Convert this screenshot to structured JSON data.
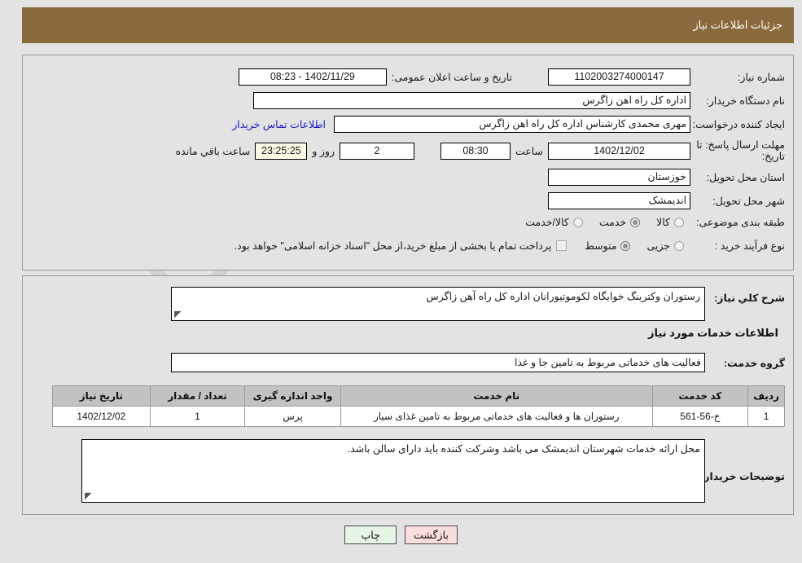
{
  "header": {
    "title": "جزئیات اطلاعات نیاز",
    "bar_color": "#8a6a3c"
  },
  "info": {
    "need_number_label": "شماره نیاز:",
    "need_number_value": "1102003274000147",
    "announce_label": "تاریخ و ساعت اعلان عمومی:",
    "announce_value": "1402/11/29 - 08:23",
    "buyer_org_label": "نام دستگاه خریدار:",
    "buyer_org_value": "اداره کل راه اهن زاگرس",
    "creator_label": "ایجاد کننده درخواست:",
    "creator_value": "مهری محمدی کارشناس اداره کل راه اهن زاگرس",
    "contact_link": "اطلاعات تماس خریدار",
    "deadline_label": "مهلت ارسال پاسخ: تا تاریخ:",
    "deadline_date": "1402/12/02",
    "hour_label": "ساعت",
    "deadline_time": "08:30",
    "days_remaining": "2",
    "days_suffix": "روز و",
    "countdown": "23:25:25",
    "countdown_suffix": "ساعت باقي مانده",
    "province_label": "استان محل تحویل:",
    "province_value": "خوزستان",
    "city_label": "شهر محل تحویل:",
    "city_value": "اندیمشک",
    "category_label": "طبقه بندی موضوعی:",
    "category_options": [
      {
        "label": "کالا",
        "selected": false
      },
      {
        "label": "خدمت",
        "selected": true
      },
      {
        "label": "کالا/خدمت",
        "selected": false
      }
    ],
    "process_label": "نوع فرآیند خرید :",
    "process_options": [
      {
        "label": "جزیی",
        "selected": false
      },
      {
        "label": "متوسط",
        "selected": true
      }
    ],
    "treasury_checkbox_checked": false,
    "payment_note": "پرداخت تمام یا بخشی از مبلغ خرید،از محل \"اسناد خزانه اسلامی\" خواهد بود."
  },
  "description": {
    "label": "شرح کلي نیاز:",
    "value": "رستوران وکترینگ خوابگاه لکوموتیورانان اداره کل راه آهن زاگرس"
  },
  "services": {
    "section_title": "اطلاعات خدمات مورد نیاز",
    "group_label": "گروه خدمت:",
    "group_value": "فعالیت های خدماتی مربوط به تامین جا و غذا",
    "table": {
      "columns": [
        "ردیف",
        "کد خدمت",
        "نام خدمت",
        "واحد اندازه گیری",
        "تعداد / مقدار",
        "تاریخ نیاز"
      ],
      "rows": [
        [
          "1",
          "خ-56-561",
          "رستوران ها و فعالیت های خدماتی مربوط به تامین غذای سیار",
          "پرس",
          "1",
          "1402/12/02"
        ]
      ]
    }
  },
  "buyer_notes": {
    "label": "توضیحات خریدار:",
    "value": "محل ارائه خدمات شهرستان اندیمشک می باشد وشرکت کننده باید دارای سالن باشد."
  },
  "footer": {
    "print_label": "چاپ",
    "back_label": "بازگشت"
  },
  "watermark": {
    "text": "AriaTender.net"
  }
}
